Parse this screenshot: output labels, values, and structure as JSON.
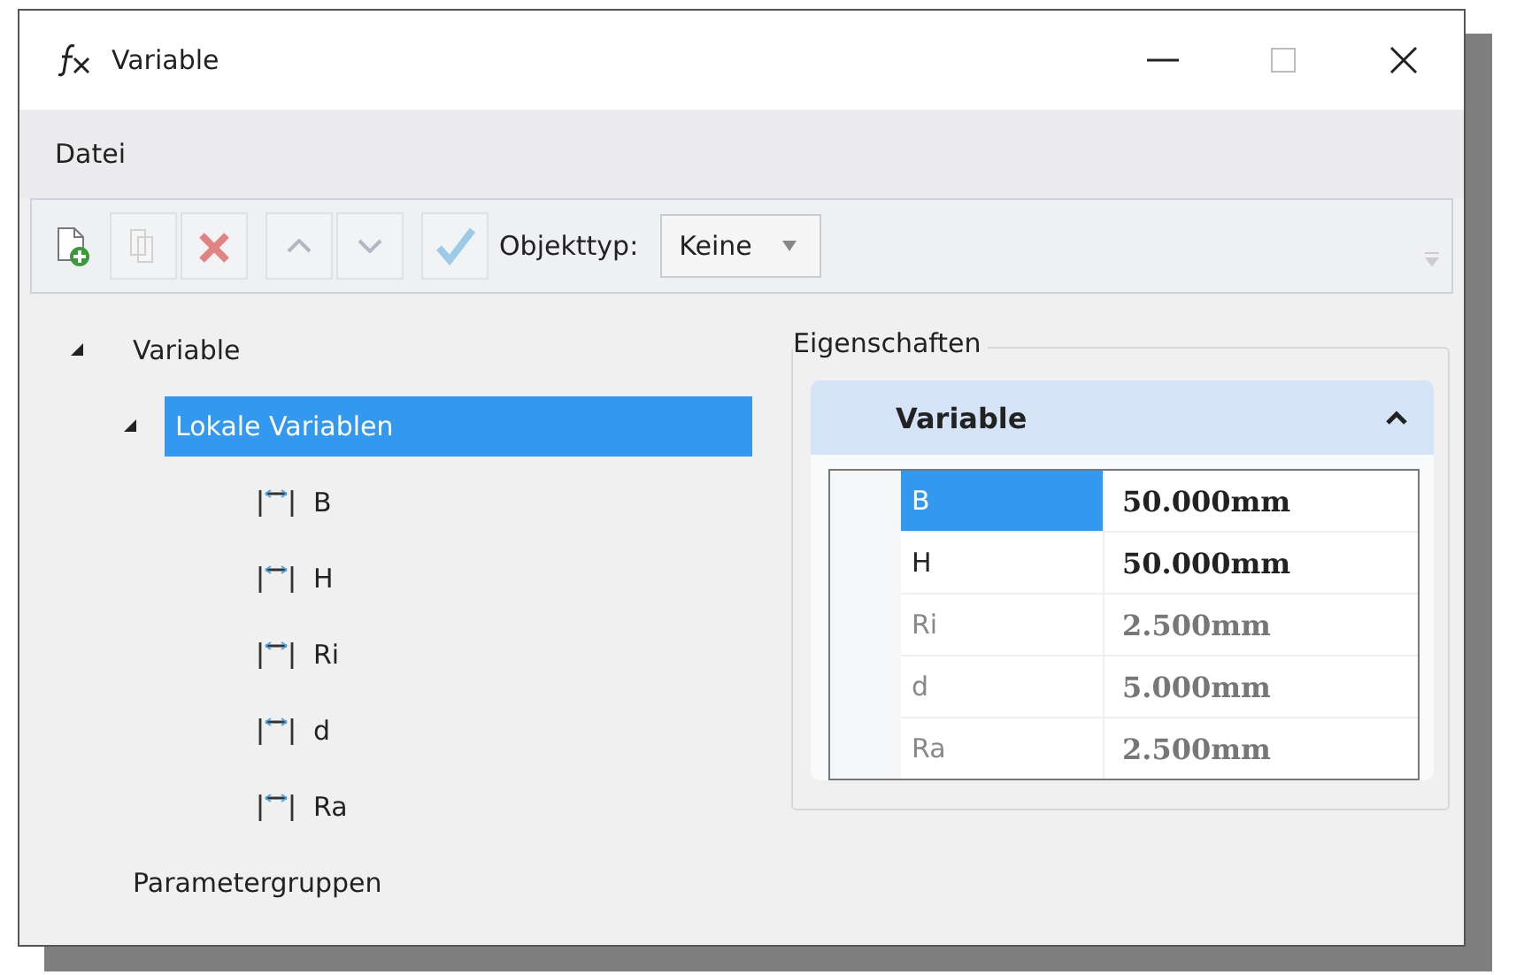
{
  "window": {
    "title": "Variable"
  },
  "menu": [
    "Datei"
  ],
  "toolbar": {
    "buttons": [
      {
        "kind": "add",
        "disabled": false
      },
      {
        "kind": "copy",
        "disabled": true
      },
      {
        "kind": "delete",
        "disabled": true
      },
      {
        "kind": "up",
        "disabled": true
      },
      {
        "kind": "down",
        "disabled": true
      },
      {
        "kind": "check",
        "disabled": true
      }
    ],
    "object_type_label": "Objekttyp:",
    "object_type_value": "Keine"
  },
  "tree": [
    {
      "label": "Variable",
      "expanded": true,
      "selected": false,
      "children": [
        {
          "label": "Lokale Variablen",
          "expanded": true,
          "selected": true,
          "children": [
            {
              "label": "B",
              "kind": "variable",
              "selected": false
            },
            {
              "label": "H",
              "kind": "variable",
              "selected": false
            },
            {
              "label": "Ri",
              "kind": "variable",
              "selected": false
            },
            {
              "label": "d",
              "kind": "variable",
              "selected": false
            },
            {
              "label": "Ra",
              "kind": "variable",
              "selected": false
            }
          ]
        }
      ]
    },
    {
      "label": "Parametergruppen",
      "selected": false
    }
  ],
  "properties": {
    "group_title": "Eigenschaften",
    "section": {
      "title": "Variable",
      "expanded": true
    },
    "rows": [
      {
        "name": "B",
        "value": "50.000mm",
        "selected": true,
        "disabled": false
      },
      {
        "name": "H",
        "value": "50.000mm",
        "selected": false,
        "disabled": false
      },
      {
        "name": "Ri",
        "value": "2.500mm",
        "selected": false,
        "disabled": true
      },
      {
        "name": "d",
        "value": "5.000mm",
        "selected": false,
        "disabled": true
      },
      {
        "name": "Ra",
        "value": "2.500mm",
        "selected": false,
        "disabled": true
      }
    ]
  }
}
